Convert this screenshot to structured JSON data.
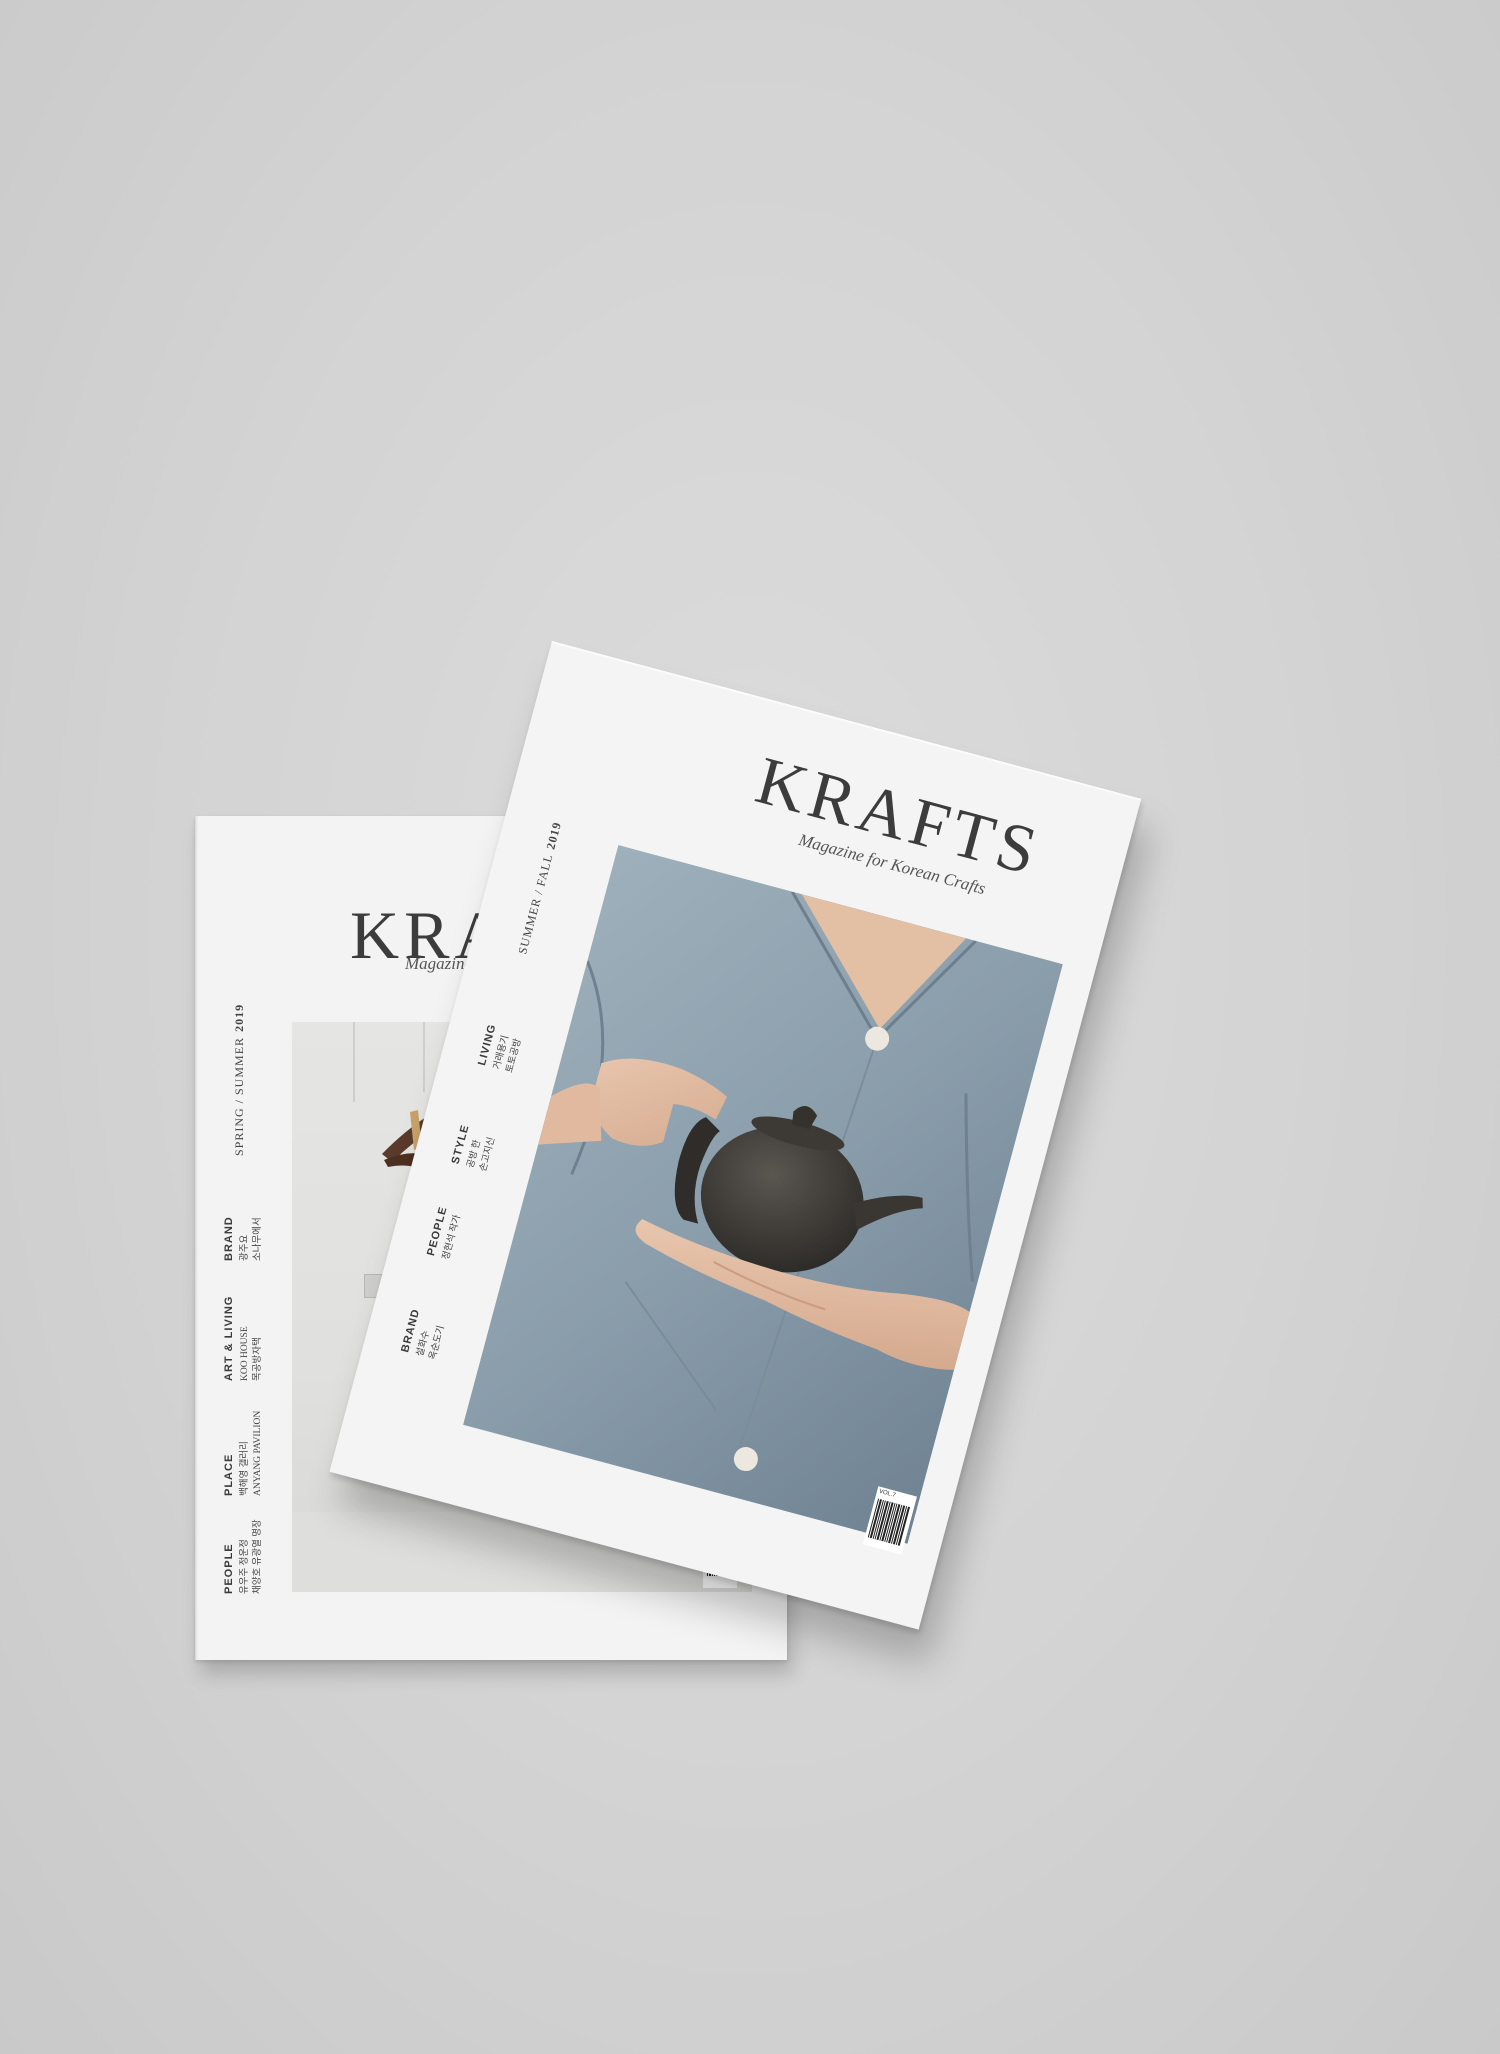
{
  "back_magazine": {
    "logo": "KRAFTS",
    "tagline": "Magazine for Korean Crafts",
    "issue_season": "SPRING / SUMMER",
    "issue_year": "2019",
    "sections": [
      {
        "label": "BRAND",
        "line1": "광주요",
        "line2": "소나무에서"
      },
      {
        "label": "ART & LIVING",
        "line1": "KOO HOUSE",
        "line2": "목공방자택"
      },
      {
        "label": "PLACE",
        "line1": "백해영 갤러리",
        "line2": "ANYANG PAVILION"
      },
      {
        "label": "PEOPLE",
        "line1": "유우주 정운정",
        "line2": "채양호 유광열 명장"
      }
    ]
  },
  "front_magazine": {
    "logo": "KRAFTS",
    "tagline": "Magazine for Korean Crafts",
    "issue_season": "SUMMER / FALL",
    "issue_year": "2019",
    "sections": [
      {
        "label": "LIVING",
        "line1": "거래용기",
        "line2": "토토공방"
      },
      {
        "label": "STYLE",
        "line1": "공방 한",
        "line2": "손고지신"
      },
      {
        "label": "PEOPLE",
        "line1": "정현석 작가",
        "line2": ""
      },
      {
        "label": "BRAND",
        "line1": "설화수",
        "line2": "옥순도기"
      }
    ],
    "barcode_text": "VOL.7"
  },
  "colors": {
    "background": "#d3d3d3",
    "paper": "#f4f4f4",
    "logo_ink": "#3c3c3c",
    "dress_blue": "#8ea1ad",
    "teapot": "#3e3b36"
  }
}
